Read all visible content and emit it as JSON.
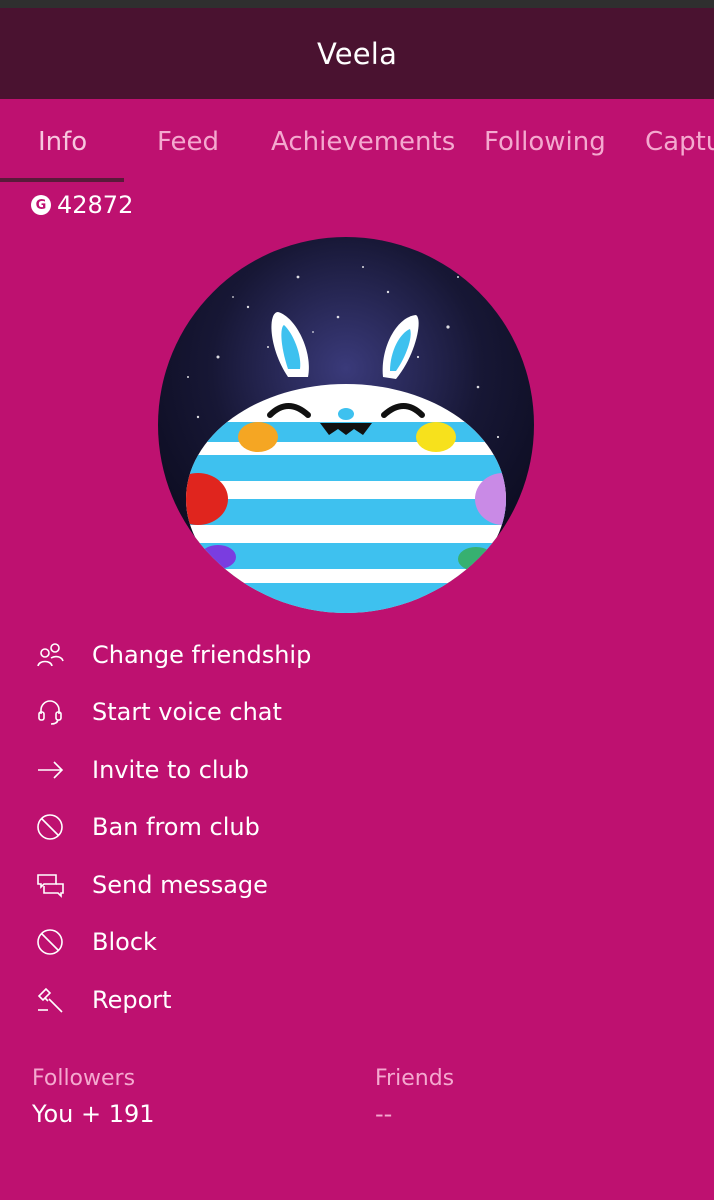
{
  "header": {
    "title": "Veela"
  },
  "tabs": [
    {
      "label": "Info",
      "active": true
    },
    {
      "label": "Feed",
      "active": false
    },
    {
      "label": "Achievements",
      "active": false
    },
    {
      "label": "Following",
      "active": false
    },
    {
      "label": "Captu",
      "active": false
    }
  ],
  "gamerscore": {
    "badge": "G",
    "value": "42872"
  },
  "actions": [
    {
      "label": "Change friendship",
      "icon": "people-icon"
    },
    {
      "label": "Start voice chat",
      "icon": "headset-icon"
    },
    {
      "label": "Invite to club",
      "icon": "arrow-right-icon"
    },
    {
      "label": "Ban from club",
      "icon": "block-circle-icon"
    },
    {
      "label": "Send message",
      "icon": "message-icon"
    },
    {
      "label": "Block",
      "icon": "block-circle-icon"
    },
    {
      "label": "Report",
      "icon": "gavel-icon"
    }
  ],
  "stats": {
    "followers_label": "Followers",
    "followers_value": "You + 191",
    "friends_label": "Friends",
    "friends_value": "--"
  },
  "colors": {
    "background": "#be1170",
    "header": "#4a1230",
    "tab_text": "#f4a9cf",
    "text": "#ffffff"
  }
}
